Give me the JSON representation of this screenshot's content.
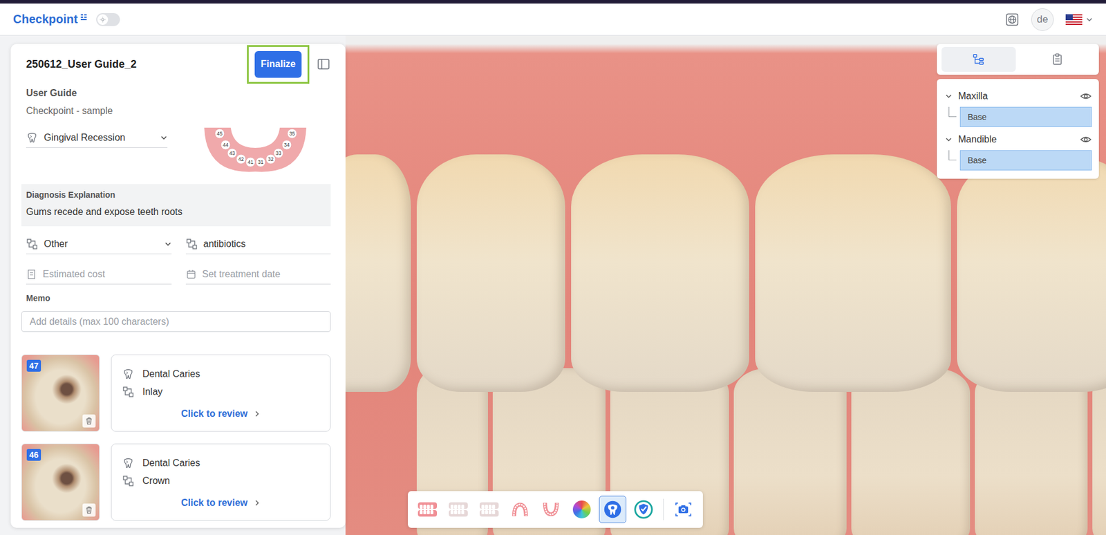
{
  "app": {
    "title": "Checkpoint",
    "theme_dark": false,
    "avatar": "de"
  },
  "case": {
    "title": "250612_User Guide_2",
    "finalize": "Finalize",
    "group": "User Guide",
    "subtitle": "Checkpoint - sample"
  },
  "diagnosis": {
    "value": "Gingival Recession"
  },
  "tooth_chart": {
    "teeth": [
      "45",
      "44",
      "43",
      "42",
      "41",
      "31",
      "32",
      "33",
      "34",
      "35"
    ]
  },
  "explanation": {
    "label": "Diagnosis Explanation",
    "text": "Gums recede and expose teeth roots"
  },
  "treatment": {
    "value": "Other",
    "detail": "antibiotics"
  },
  "cost": {
    "placeholder": "Estimated cost"
  },
  "date": {
    "placeholder": "Set treatment date"
  },
  "memo": {
    "label": "Memo",
    "placeholder": "Add details (max 100 characters)"
  },
  "findings": [
    {
      "tooth": "47",
      "diagnosis": "Dental Caries",
      "treatment": "Inlay",
      "action": "Click to review"
    },
    {
      "tooth": "46",
      "diagnosis": "Dental Caries",
      "treatment": "Crown",
      "action": "Click to review"
    }
  ],
  "view_tabs": [
    {
      "kind": "tree",
      "selected": true
    },
    {
      "kind": "report",
      "selected": false
    }
  ],
  "layers": [
    {
      "name": "Maxilla",
      "expanded": true,
      "visible": true,
      "children": [
        {
          "name": "Base",
          "selected": true
        }
      ]
    },
    {
      "name": "Mandible",
      "expanded": true,
      "visible": true,
      "children": [
        {
          "name": "Base",
          "selected": true
        }
      ]
    }
  ],
  "toolbar": [
    {
      "kind": "jaws",
      "selected": false,
      "disabled": false
    },
    {
      "kind": "jaws",
      "selected": false,
      "disabled": true
    },
    {
      "kind": "jaws",
      "selected": false,
      "disabled": true
    },
    {
      "kind": "upper",
      "selected": false,
      "disabled": false
    },
    {
      "kind": "lower",
      "selected": false,
      "disabled": false
    },
    {
      "kind": "color",
      "selected": false,
      "disabled": false
    },
    {
      "kind": "tooth",
      "selected": true,
      "disabled": false
    },
    {
      "kind": "check",
      "selected": false,
      "disabled": false
    },
    {
      "kind": "camera",
      "selected": false,
      "disabled": false
    }
  ]
}
